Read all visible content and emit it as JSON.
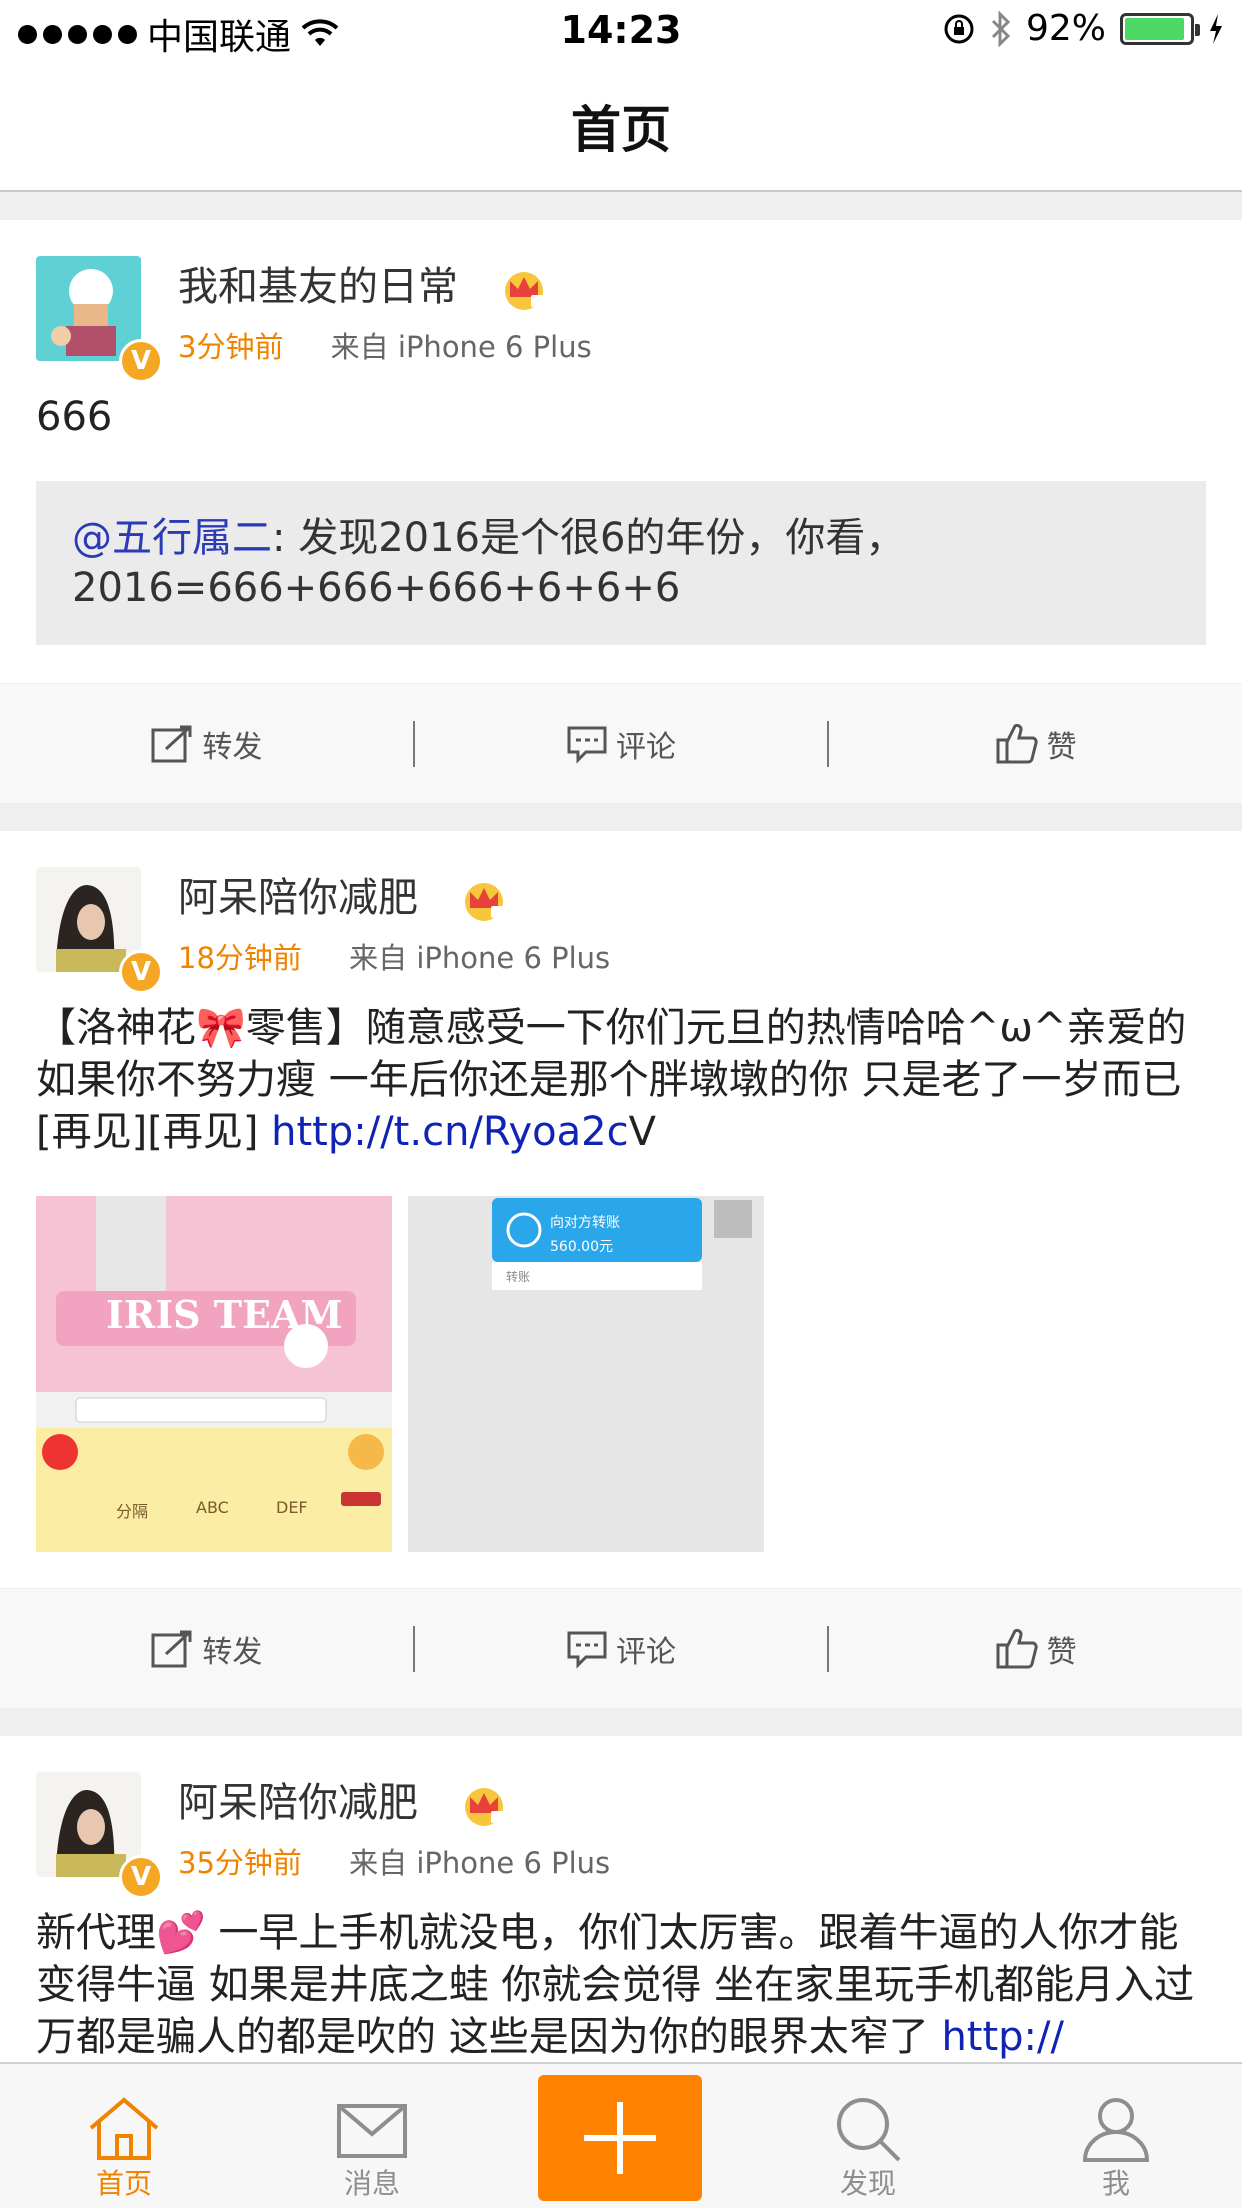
{
  "status_bar": {
    "carrier": "中国联通",
    "time": "14:23",
    "battery": "92%",
    "battery_level": 0.92,
    "signal_dots": 5
  },
  "nav": {
    "title": "首页"
  },
  "actions": {
    "repost": "转发",
    "comment": "评论",
    "like": "赞"
  },
  "posts": [
    {
      "username": "我和基友的日常",
      "time": "3分钟前",
      "source": "来自 iPhone 6 Plus",
      "text": "666",
      "retweet": {
        "mention": "@五行属二",
        "text": ": 发现2016是个很6的年份，你看，2016=666+666+666+6+6+6"
      }
    },
    {
      "username": "阿呆陪你减肥",
      "time": "18分钟前",
      "source": "来自 iPhone 6 Plus",
      "text": "【洛神花🎀零售】随意感受一下你们元旦的热情哈哈^ω^亲爱的 如果你不努力瘦 一年后你还是那个胖墩墩的你 只是老了一岁而已[再见][再见] ",
      "link": "http://t.cn/Ryoa2c",
      "text_after_link": "V",
      "images": [
        {
          "title": "IRIS TEAM",
          "keys": [
            "分隔",
            "ABC",
            "DEF"
          ]
        },
        {
          "transfer_title": "向对方转账",
          "transfer_amount": "560.00元",
          "transfer_label": "转账"
        }
      ]
    },
    {
      "username": "阿呆陪你减肥",
      "time": "35分钟前",
      "source": "来自 iPhone 6 Plus",
      "text": "新代理💕 一早上手机就没电，你们太厉害。跟着牛逼的人你才能变得牛逼 如果是井底之蛙 你就会觉得 坐在家里玩手机都能月入过万都是骗人的都是吹的 这些是因为你的眼界太窄了 ",
      "link": "http://"
    }
  ],
  "tabbar": {
    "home": "首页",
    "messages": "消息",
    "discover": "发现",
    "me": "我"
  },
  "colors": {
    "accent": "#ff8200",
    "link": "#0f23b4",
    "time": "#f08300",
    "verified": "#f5a623"
  }
}
